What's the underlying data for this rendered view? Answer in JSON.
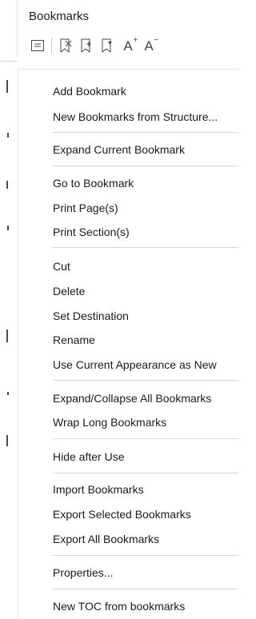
{
  "panel": {
    "title": "Bookmarks"
  },
  "toolbar": {
    "icons": [
      "options-icon",
      "delete-bookmark-icon",
      "new-bookmark-icon",
      "new-bookmark-from-structure-icon",
      "increase-text-size-icon",
      "decrease-text-size-icon"
    ],
    "increase_text": "A",
    "increase_sup": "+",
    "decrease_text": "A",
    "decrease_sup": "−"
  },
  "menu": {
    "groups": [
      [
        "Add Bookmark",
        "New Bookmarks from Structure..."
      ],
      [
        "Expand Current Bookmark"
      ],
      [
        "Go to Bookmark",
        "Print Page(s)",
        "Print Section(s)"
      ],
      [
        "Cut",
        "Delete",
        "Set Destination",
        "Rename",
        "Use Current Appearance as New"
      ],
      [
        "Expand/Collapse All Bookmarks",
        "Wrap Long Bookmarks"
      ],
      [
        "Hide after Use"
      ],
      [
        "Import Bookmarks",
        "Export Selected Bookmarks",
        "Export All Bookmarks"
      ],
      [
        "Properties..."
      ],
      [
        "New TOC from bookmarks"
      ]
    ]
  }
}
